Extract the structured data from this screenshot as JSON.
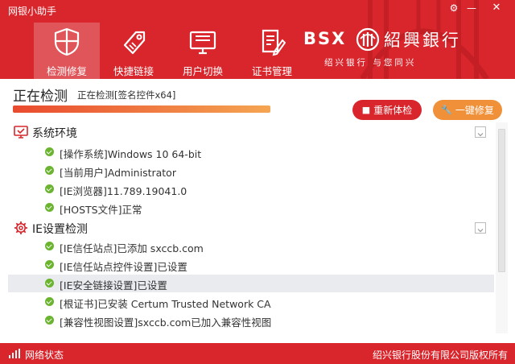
{
  "app": {
    "title": "网银小助手"
  },
  "window_controls": {
    "settings": "⚙",
    "minimize": "—",
    "close": "✕"
  },
  "nav": [
    {
      "label": "检测修复",
      "icon": "shield-icon",
      "active": true
    },
    {
      "label": "快捷链接",
      "icon": "tag-icon",
      "active": false
    },
    {
      "label": "用户切换",
      "icon": "monitor-icon",
      "active": false
    },
    {
      "label": "证书管理",
      "icon": "certificate-icon",
      "active": false
    }
  ],
  "brand": {
    "letters": "BSX",
    "name": "紹興銀行",
    "slogan": "绍兴银行 与您同兴",
    "logo_icon": "bank-logo-icon"
  },
  "status": {
    "title": "正在检测",
    "detail": "正在检测[签名控件x64]",
    "progress_percent": 100
  },
  "actions": {
    "recheck_label": "重新体检",
    "recheck_icon": "stop-icon",
    "fix_label": "一键修复",
    "fix_icon": "wrench-icon"
  },
  "sections": [
    {
      "title": "系统环境",
      "icon": "monitor-check-icon",
      "items": [
        "[操作系统]Windows 10 64-bit",
        "[当前用户]Administrator",
        "[IE浏览器]11.789.19041.0",
        "[HOSTS文件]正常"
      ]
    },
    {
      "title": "IE设置检测",
      "icon": "gear-icon",
      "items": [
        "[IE信任站点]已添加 sxccb.com",
        "[IE信任站点控件设置]已设置",
        "[IE安全链接设置]已设置",
        "[根证书]已安装  Certum Trusted Network CA",
        "[兼容性视图设置]sxccb.com已加入兼容性视图"
      ],
      "selected_index": 2
    }
  ],
  "footer": {
    "network_label": "网络状态",
    "network_icon": "signal-icon",
    "copyright": "绍兴银行股份有限公司版权所有"
  },
  "colors": {
    "brand_red": "#d8262c",
    "accent_orange": "#f0913a",
    "check_green": "#6ab42f"
  }
}
